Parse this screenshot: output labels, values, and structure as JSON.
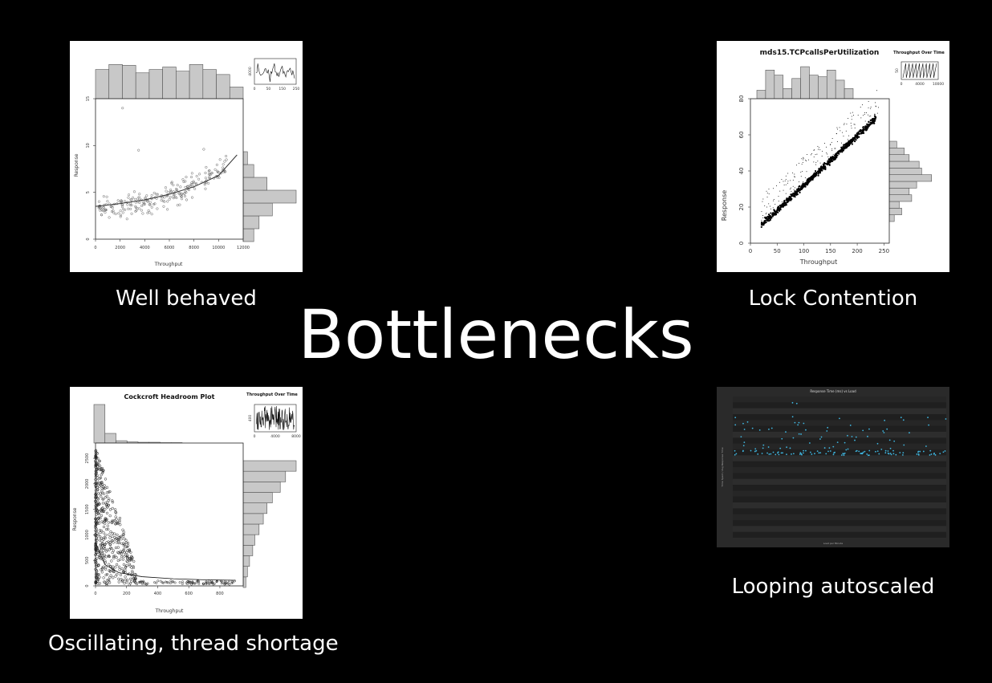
{
  "slide": {
    "title": "Bottlenecks",
    "captions": {
      "tl": "Well behaved",
      "tr": "Lock Contention",
      "bl": "Oscillating, thread shortage",
      "br": "Looping autoscaled"
    }
  },
  "chart_data": [
    {
      "type": "scatter",
      "id": "well-behaved",
      "title": "",
      "xlabel": "Throughput",
      "ylabel": "Response",
      "xlim": [
        0,
        12000
      ],
      "ylim": [
        0,
        15
      ],
      "x_ticks": [
        "0",
        "2000",
        "4000",
        "6000",
        "8000",
        "10000",
        "12000"
      ],
      "y_ticks": [
        "0",
        "5",
        "10",
        "15"
      ],
      "grid": false,
      "trend": {
        "x": [
          0,
          2000,
          4000,
          6000,
          8000,
          10000,
          11500
        ],
        "y": [
          3.5,
          3.8,
          4.2,
          4.8,
          5.6,
          6.8,
          9.0
        ]
      },
      "top_histogram": [
        0.7,
        0.82,
        0.8,
        0.62,
        0.7,
        0.76,
        0.66,
        0.82,
        0.7,
        0.58,
        0.28
      ],
      "right_histogram": [
        0.2,
        0.3,
        0.55,
        1.0,
        0.45,
        0.2,
        0.08
      ],
      "inset": {
        "title": "",
        "x_ticks": [
          "0",
          "50",
          "150",
          "250"
        ],
        "y_ticks": [
          "4000"
        ]
      }
    },
    {
      "type": "scatter",
      "id": "lock-contention",
      "title": "mds15.TCPcallsPerUtilization",
      "xlabel": "Throughput",
      "ylabel": "Response",
      "xlim": [
        0,
        260
      ],
      "ylim": [
        0,
        80
      ],
      "x_ticks": [
        "0",
        "50",
        "100",
        "150",
        "200",
        "250"
      ],
      "y_ticks": [
        "0",
        "20",
        "40",
        "60",
        "80"
      ],
      "grid": false,
      "trend": {
        "x": [
          20,
          230
        ],
        "y": [
          10,
          68
        ]
      },
      "top_histogram": [
        0.25,
        0.85,
        0.7,
        0.3,
        0.6,
        0.95,
        0.7,
        0.65,
        0.85,
        0.55,
        0.3
      ],
      "right_histogram": [
        0.1,
        0.25,
        0.2,
        0.45,
        0.4,
        0.55,
        0.85,
        0.65,
        0.6,
        0.4,
        0.3,
        0.15
      ],
      "inset": {
        "title": "Throughput Over Time",
        "x_ticks": [
          "0",
          "4000",
          "10000"
        ],
        "y_ticks": [
          "50"
        ]
      }
    },
    {
      "type": "scatter",
      "id": "oscillating",
      "title": "Cockcroft Headroom Plot",
      "xlabel": "Throughput",
      "ylabel": "Response",
      "xlim": [
        0,
        950
      ],
      "ylim": [
        0,
        2800
      ],
      "x_ticks": [
        "0",
        "200",
        "400",
        "600",
        "800"
      ],
      "y_ticks": [
        "0",
        "500",
        "1000",
        "1500",
        "2000",
        "2500"
      ],
      "grid": false,
      "trend": {
        "x": [
          0,
          60,
          150,
          300,
          500,
          700,
          900
        ],
        "y": [
          850,
          420,
          260,
          180,
          140,
          120,
          110
        ]
      },
      "top_histogram": [
        1.0,
        0.25,
        0.06,
        0.03,
        0.02,
        0.02,
        0.01,
        0.01
      ],
      "right_histogram": [
        0.05,
        0.08,
        0.12,
        0.18,
        0.22,
        0.3,
        0.38,
        0.45,
        0.55,
        0.7,
        0.8,
        1.0
      ],
      "inset": {
        "title": "Throughput Over Time",
        "x_ticks": [
          "0",
          "4000",
          "8000"
        ],
        "y_ticks": [
          "400"
        ]
      }
    },
    {
      "type": "scatter",
      "id": "looping-autoscaled",
      "title": "Response Time (ms) vs Load",
      "xlabel": "Load per Minute",
      "ylabel": "Time Spent / Avg Response Time",
      "xlim": [
        0,
        100
      ],
      "ylim": [
        0,
        180
      ],
      "grid": true,
      "colors": {
        "points": "#3fb6e0",
        "background": "#2a2a2a"
      }
    }
  ]
}
